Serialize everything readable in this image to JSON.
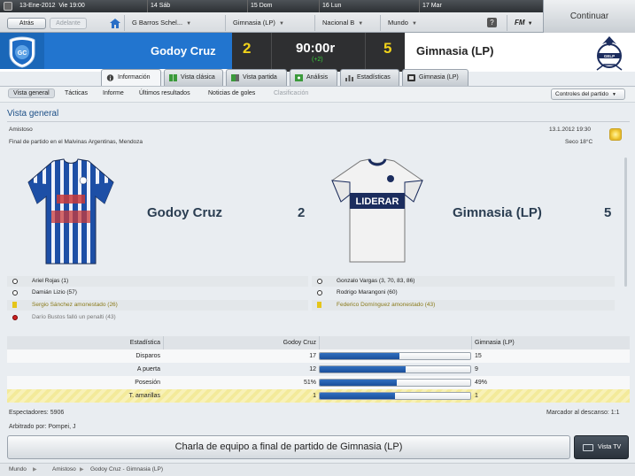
{
  "calendar": {
    "date": "13-Ene-2012",
    "weekday_time": "Vie 19:00",
    "days": [
      "14 Sáb",
      "15 Dom",
      "16 Lun",
      "17 Mar"
    ]
  },
  "nav": {
    "back": "Atrás",
    "forward": "Adelante",
    "manager": "G Barros Schel...",
    "club": "Gimnasia (LP)",
    "league": "Nacional B",
    "world": "Mundo",
    "help": "?",
    "fm": "FM",
    "continue": "Continuar"
  },
  "score": {
    "home_team": "Godoy Cruz",
    "away_team": "Gimnasia (LP)",
    "home_goals": "2",
    "away_goals": "5",
    "time": "90:00r",
    "added": "(+2)",
    "colors": {
      "home": "#1a67b8",
      "board": "#2e2f31",
      "goals": "#f0d21a"
    }
  },
  "tabs": [
    {
      "label": "Información",
      "icon": "info-icon"
    },
    {
      "label": "Vista clásica",
      "icon": "pitch-icon"
    },
    {
      "label": "Vista partida",
      "icon": "split-pitch-icon"
    },
    {
      "label": "Análisis",
      "icon": "analysis-icon"
    },
    {
      "label": "Estadísticas",
      "icon": "stats-icon"
    },
    {
      "label": "Gimnasia (LP)",
      "icon": "team-icon"
    }
  ],
  "subnav": {
    "items": [
      "Vista general",
      "Tácticas",
      "Informe",
      "Últimos resultados",
      "Noticias de goles",
      "Clasificación"
    ],
    "controls": "Controles del partido"
  },
  "overview": {
    "title": "Vista general",
    "competition": "Amistoso",
    "datetime": "13.1.2012 19:30",
    "venue": "Final de partido en el Malvinas Argentinas, Mendoza",
    "weather": "Seco 18°C",
    "home_team": "Godoy Cruz",
    "home_goals": "2",
    "away_team": "Gimnasia (LP)",
    "away_goals": "5",
    "away_shirt_sponsor": "LIDERAR"
  },
  "events": {
    "home": [
      {
        "type": "goal",
        "text": "Ariel Rojas (1)"
      },
      {
        "type": "goal",
        "text": "Damián Lizio (57)"
      },
      {
        "type": "booking",
        "text": "Sergio Sánchez amonestado (26)"
      },
      {
        "type": "penalty-miss",
        "text": "Darío Bustos falló un penalti (43)"
      }
    ],
    "away": [
      {
        "type": "goal",
        "text": "Gonzalo Vargas (3, 70, 83, 86)"
      },
      {
        "type": "goal",
        "text": "Rodrigo Marangoni (60)"
      },
      {
        "type": "booking",
        "text": "Federico Domínguez amonestado (43)"
      }
    ]
  },
  "stats": {
    "header": {
      "name": "Estadística",
      "home": "Godoy Cruz",
      "away": "Gimnasia (LP)"
    },
    "rows": [
      {
        "name": "Disparos",
        "home": "17",
        "away": "15",
        "home_share": 0.53
      },
      {
        "name": "A puerta",
        "home": "12",
        "away": "9",
        "home_share": 0.57
      },
      {
        "name": "Posesión",
        "home": "51%",
        "away": "49%",
        "home_share": 0.51
      },
      {
        "name": "T. amarillas",
        "home": "1",
        "away": "1",
        "home_share": 0.5
      }
    ]
  },
  "footer": {
    "attendance": "Espectadores: 5906",
    "halftime": "Marcador al descanso: 1:1",
    "referee": "Arbitrado por: Pompei, J",
    "team_talk": "Charla de equipo a final de partido de Gimnasia (LP)",
    "tv": "Vista TV"
  },
  "breadcrumb": [
    "Mundo",
    "Amistoso",
    "Godoy Cruz - Gimnasia (LP)"
  ]
}
